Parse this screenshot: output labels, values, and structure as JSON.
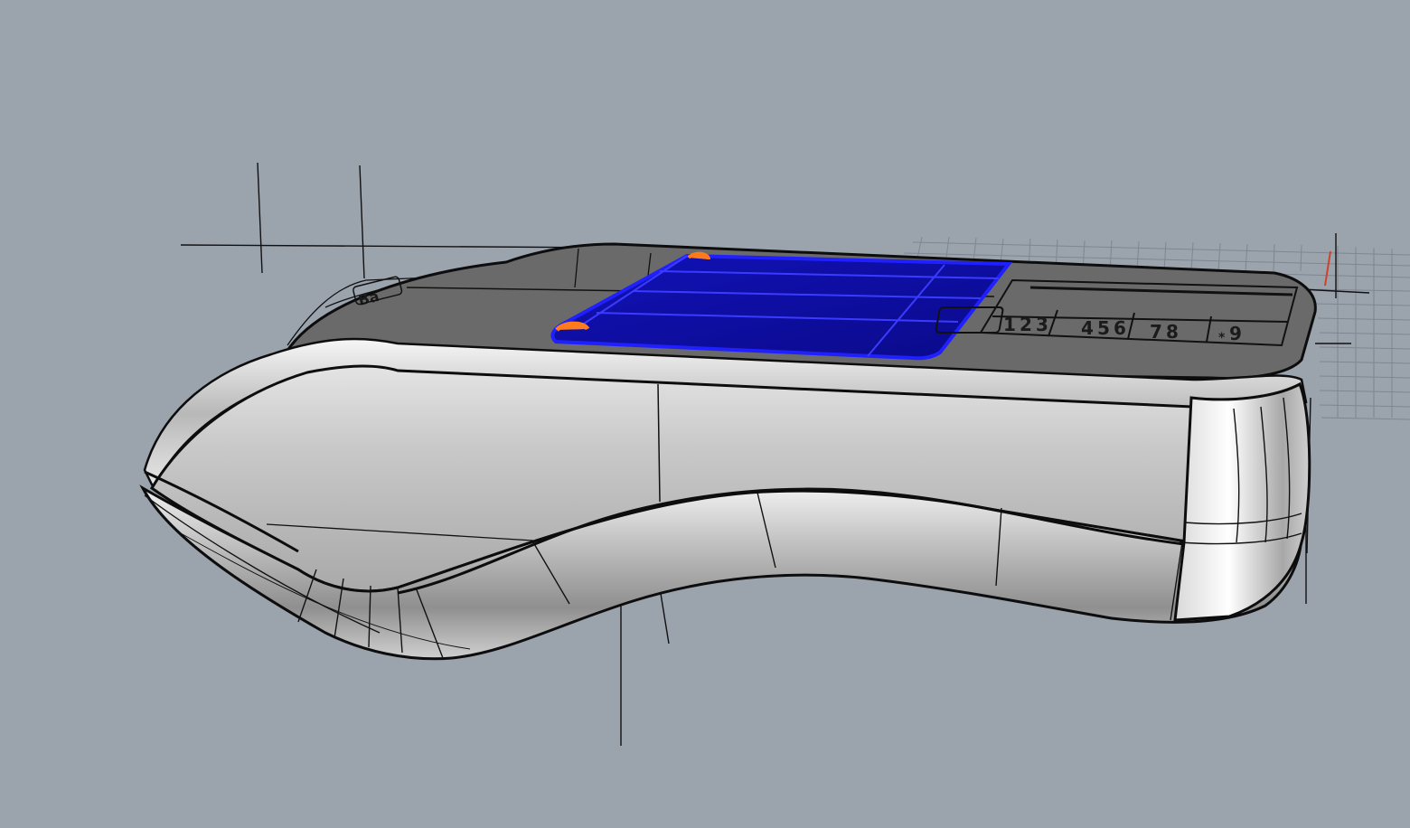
{
  "viewport": {
    "background": "#9ba3ad",
    "projection": "perspective",
    "display_mode": "shaded"
  },
  "model": {
    "object": "handheld-terminal",
    "body_color": "#b6b6b6",
    "top_color": "#686868",
    "selection_color": "#1f1fd6",
    "control_point_color": "#ff7a1a"
  },
  "keypad": {
    "row_visible": [
      "1",
      "2",
      "3",
      "4",
      "5",
      "6",
      "7",
      "8",
      "9",
      "*"
    ]
  },
  "side_label": "Ba"
}
